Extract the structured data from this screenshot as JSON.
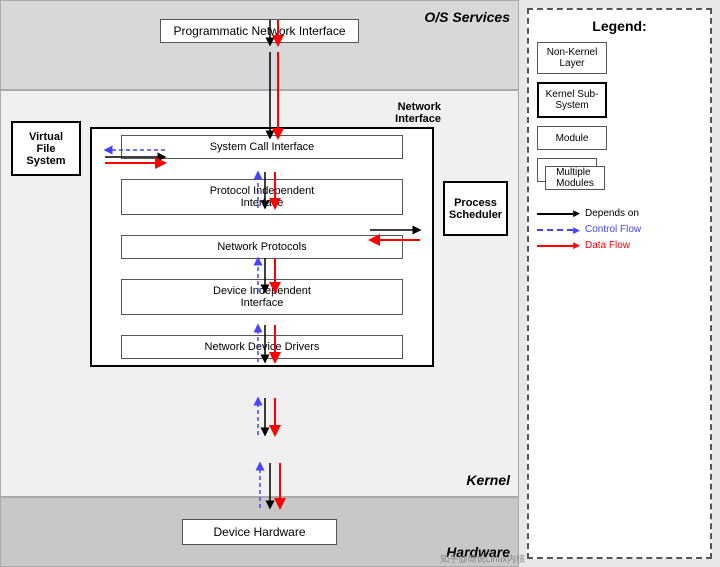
{
  "diagram": {
    "os_services_label": "O/S Services",
    "kernel_label": "Kernel",
    "hardware_label": "Hardware",
    "network_interface_label": "Network\nInterface",
    "programmatic_box": "Programmatic Network Interface",
    "vfs_box": "Virtual File\nSystem",
    "process_scheduler": "Process\nScheduler",
    "system_call_interface": "System Call Interface",
    "protocol_independent": "Protocol Independent\nInterface",
    "network_protocols": "Network Protocols",
    "device_independent": "Device Independent\nInterface",
    "network_device_drivers": "Network Device Drivers",
    "device_hardware": "Device Hardware"
  },
  "legend": {
    "title": "Legend:",
    "non_kernel_label": "Non-Kernel\nLayer",
    "kernel_sub_label": "Kernel Sub-\nSystem",
    "module_label": "Module",
    "multiple_modules_label": "Multiple\nModules",
    "depends_on": "Depends on",
    "control_flow": "Control Flow",
    "data_flow": "Data Flow"
  }
}
